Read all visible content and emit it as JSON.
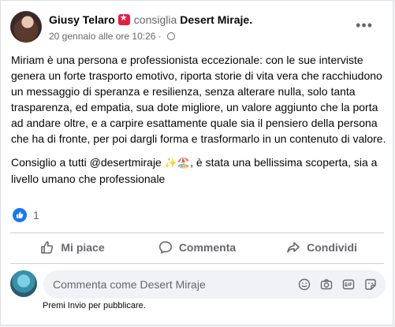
{
  "post": {
    "author": "Giusy Telaro",
    "action_text": "consiglia",
    "page": "Desert Miraje.",
    "date": "20 gennaio alle ore 10:26",
    "separator": "·",
    "more_label": "•••",
    "paragraph1": "Miriam è una persona e professionista eccezionale: con le sue interviste genera un forte trasporto emotivo, riporta storie di vita vera che racchiudono un messaggio di speranza e resilienza, senza alterare nulla, solo tanta trasparenza, ed empatia, sua dote migliore, un valore aggiunto che la porta ad andare oltre, e a carpire esattamente quale sia il pensiero della persona che ha di fronte, per poi dargli forma e trasformarlo in un contenuto di valore.",
    "paragraph2_before": "Consiglio a tutti @desertmiraje ",
    "paragraph2_emoji": "✨🏖️",
    "paragraph2_after": ", è stata una bellissima scoperta, sia a livello umano che professionale"
  },
  "reactions": {
    "count": "1",
    "icon": "like-icon"
  },
  "actions": {
    "like": "Mi piace",
    "comment": "Commenta",
    "share": "Condividi"
  },
  "comment": {
    "placeholder": "Commenta come Desert Miraje",
    "hint": "Premi Invio per pubblicare.",
    "icons": [
      "smiley-icon",
      "camera-icon",
      "gif-icon",
      "sticker-icon"
    ]
  },
  "colors": {
    "accent": "#1877f2",
    "badge": "#e41e3f",
    "muted": "#65676b"
  }
}
